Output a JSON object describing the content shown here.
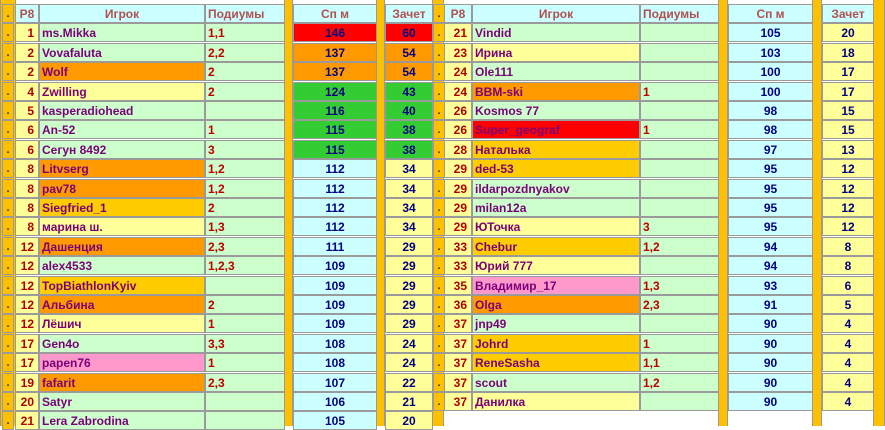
{
  "headers": {
    "dot": ".",
    "rank": "Р8",
    "player": "Игрок",
    "podiums": "Подиумы",
    "sp": "Сп м",
    "score": "Зачет"
  },
  "colors": {
    "green": "#ccffcc",
    "yellow": "#ffff99",
    "blue": "#ccffff",
    "orange": "#ffcc00",
    "dark_orange": "#ff9900",
    "pink": "#ff99cc",
    "red": "#ff0000",
    "green_hi": "#33cc33",
    "sep": "#ffc000"
  },
  "left_rows": [
    {
      "rank": "1",
      "name": "ms.Mikka",
      "pod": "1,1",
      "sp": "146",
      "score": "60",
      "name_bg": "green",
      "sp_bg": "red",
      "score_bg": "red"
    },
    {
      "rank": "2",
      "name": "Vovafaluta",
      "pod": "2,2",
      "sp": "137",
      "score": "54",
      "name_bg": "green",
      "sp_bg": "dark_orange",
      "score_bg": "dark_orange"
    },
    {
      "rank": "2",
      "name": "Wolf",
      "pod": "2",
      "sp": "137",
      "score": "54",
      "name_bg": "dark_orange",
      "sp_bg": "dark_orange",
      "score_bg": "dark_orange"
    },
    {
      "rank": "4",
      "name": "Zwilling",
      "pod": "2",
      "sp": "124",
      "score": "43",
      "name_bg": "yellow",
      "sp_bg": "green_hi",
      "score_bg": "green_hi"
    },
    {
      "rank": "5",
      "name": "kasperadiohead",
      "pod": "",
      "sp": "116",
      "score": "40",
      "name_bg": "green",
      "sp_bg": "green_hi",
      "score_bg": "green_hi"
    },
    {
      "rank": "6",
      "name": "An-52",
      "pod": "1",
      "sp": "115",
      "score": "38",
      "name_bg": "green",
      "sp_bg": "green_hi",
      "score_bg": "green_hi"
    },
    {
      "rank": "6",
      "name": "Сегун 8492",
      "pod": "3",
      "sp": "115",
      "score": "38",
      "name_bg": "green",
      "sp_bg": "green_hi",
      "score_bg": "green_hi"
    },
    {
      "rank": "8",
      "name": "Litvserg",
      "pod": "1,2",
      "sp": "112",
      "score": "34",
      "name_bg": "dark_orange",
      "sp_bg": "blue",
      "score_bg": "yellow"
    },
    {
      "rank": "8",
      "name": "pav78",
      "pod": "1,2",
      "sp": "112",
      "score": "34",
      "name_bg": "dark_orange",
      "sp_bg": "blue",
      "score_bg": "yellow"
    },
    {
      "rank": "8",
      "name": "Siegfried_1",
      "pod": "2",
      "sp": "112",
      "score": "34",
      "name_bg": "orange",
      "sp_bg": "blue",
      "score_bg": "yellow"
    },
    {
      "rank": "8",
      "name": "марина ш.",
      "pod": "1,3",
      "sp": "112",
      "score": "34",
      "name_bg": "yellow",
      "sp_bg": "blue",
      "score_bg": "yellow"
    },
    {
      "rank": "12",
      "name": "Дашенция",
      "pod": "2,3",
      "sp": "111",
      "score": "29",
      "name_bg": "dark_orange",
      "sp_bg": "blue",
      "score_bg": "yellow"
    },
    {
      "rank": "12",
      "name": "alex4533",
      "pod": "1,2,3",
      "sp": "109",
      "score": "29",
      "name_bg": "green",
      "sp_bg": "blue",
      "score_bg": "yellow"
    },
    {
      "rank": "12",
      "name": "TopBiathlonKyiv",
      "pod": "",
      "sp": "109",
      "score": "29",
      "name_bg": "orange",
      "sp_bg": "blue",
      "score_bg": "yellow"
    },
    {
      "rank": "12",
      "name": "Альбина",
      "pod": "2",
      "sp": "109",
      "score": "29",
      "name_bg": "dark_orange",
      "sp_bg": "blue",
      "score_bg": "yellow"
    },
    {
      "rank": "12",
      "name": "Лёшич",
      "pod": "1",
      "sp": "109",
      "score": "29",
      "name_bg": "yellow",
      "sp_bg": "blue",
      "score_bg": "yellow"
    },
    {
      "rank": "17",
      "name": "Gen4o",
      "pod": "3,3",
      "sp": "108",
      "score": "24",
      "name_bg": "green",
      "sp_bg": "blue",
      "score_bg": "yellow"
    },
    {
      "rank": "17",
      "name": "papen76",
      "pod": "1",
      "sp": "108",
      "score": "24",
      "name_bg": "pink",
      "sp_bg": "blue",
      "score_bg": "yellow"
    },
    {
      "rank": "19",
      "name": "fafarit",
      "pod": "2,3",
      "sp": "107",
      "score": "22",
      "name_bg": "dark_orange",
      "sp_bg": "blue",
      "score_bg": "yellow"
    },
    {
      "rank": "20",
      "name": "Satyr",
      "pod": "",
      "sp": "106",
      "score": "21",
      "name_bg": "green",
      "sp_bg": "blue",
      "score_bg": "yellow"
    },
    {
      "rank": "21",
      "name": "Lera Zabrodina",
      "pod": "",
      "sp": "105",
      "score": "20",
      "name_bg": "green",
      "sp_bg": "blue",
      "score_bg": "yellow"
    }
  ],
  "right_rows": [
    {
      "rank": "21",
      "name": "Vindid",
      "pod": "",
      "sp": "105",
      "score": "20",
      "name_bg": "green"
    },
    {
      "rank": "23",
      "name": "Ирина",
      "pod": "",
      "sp": "103",
      "score": "18",
      "name_bg": "yellow"
    },
    {
      "rank": "24",
      "name": "Ole111",
      "pod": "",
      "sp": "100",
      "score": "17",
      "name_bg": "green"
    },
    {
      "rank": "24",
      "name": "BBM-ski",
      "pod": "1",
      "sp": "100",
      "score": "17",
      "name_bg": "dark_orange"
    },
    {
      "rank": "26",
      "name": "Kosmos 77",
      "pod": "",
      "sp": "98",
      "score": "15",
      "name_bg": "green"
    },
    {
      "rank": "26",
      "name": "Super_geograf",
      "pod": "1",
      "sp": "98",
      "score": "15",
      "name_bg": "red"
    },
    {
      "rank": "28",
      "name": "Наталька",
      "pod": "",
      "sp": "97",
      "score": "13",
      "name_bg": "orange"
    },
    {
      "rank": "29",
      "name": "ded-53",
      "pod": "",
      "sp": "95",
      "score": "12",
      "name_bg": "orange"
    },
    {
      "rank": "29",
      "name": "ildarpozdnyakov",
      "pod": "",
      "sp": "95",
      "score": "12",
      "name_bg": "green"
    },
    {
      "rank": "29",
      "name": "milan12a",
      "pod": "",
      "sp": "95",
      "score": "12",
      "name_bg": "green"
    },
    {
      "rank": "29",
      "name": "ЮТочка",
      "pod": "3",
      "sp": "95",
      "score": "12",
      "name_bg": "yellow"
    },
    {
      "rank": "33",
      "name": "Chebur",
      "pod": "1,2",
      "sp": "94",
      "score": "8",
      "name_bg": "orange"
    },
    {
      "rank": "33",
      "name": "Юрий 777",
      "pod": "",
      "sp": "94",
      "score": "8",
      "name_bg": "yellow"
    },
    {
      "rank": "35",
      "name": "Владимир_17",
      "pod": "1,3",
      "sp": "93",
      "score": "6",
      "name_bg": "pink"
    },
    {
      "rank": "36",
      "name": "Olga",
      "pod": "2,3",
      "sp": "91",
      "score": "5",
      "name_bg": "dark_orange"
    },
    {
      "rank": "37",
      "name": "jnp49",
      "pod": "",
      "sp": "90",
      "score": "4",
      "name_bg": "green"
    },
    {
      "rank": "37",
      "name": "Johrd",
      "pod": "1",
      "sp": "90",
      "score": "4",
      "name_bg": "orange"
    },
    {
      "rank": "37",
      "name": "ReneSasha",
      "pod": "1,1",
      "sp": "90",
      "score": "4",
      "name_bg": "orange"
    },
    {
      "rank": "37",
      "name": "scout",
      "pod": "1,2",
      "sp": "90",
      "score": "4",
      "name_bg": "green"
    },
    {
      "rank": "37",
      "name": "Данилка",
      "pod": "",
      "sp": "90",
      "score": "4",
      "name_bg": "yellow"
    }
  ]
}
